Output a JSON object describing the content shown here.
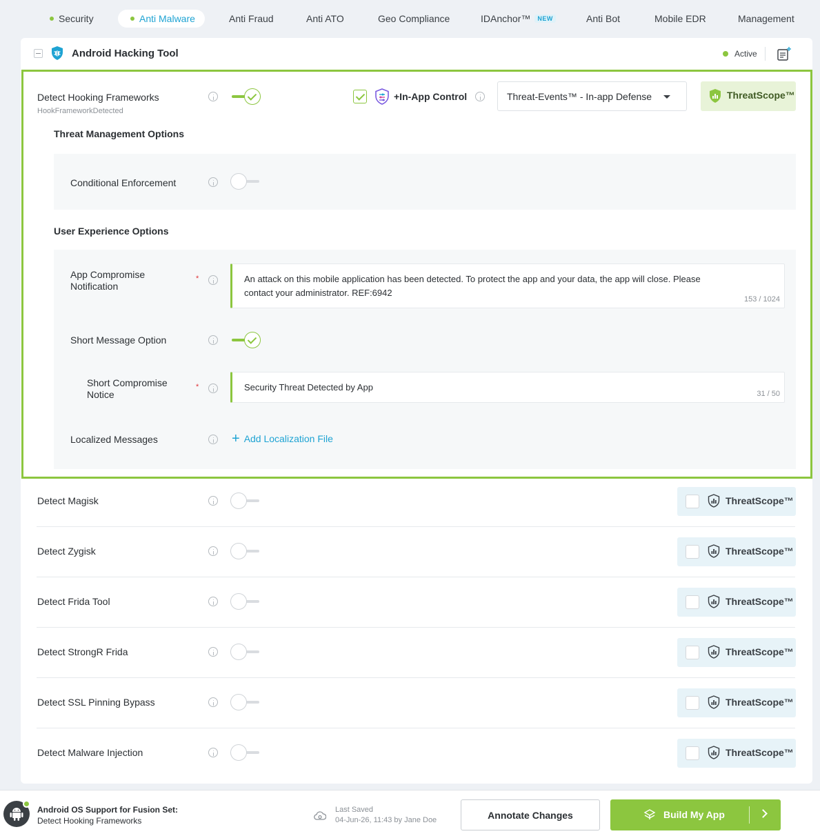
{
  "nav": {
    "tabs": [
      {
        "label": "Security"
      },
      {
        "label": "Anti Malware"
      },
      {
        "label": "Anti Fraud"
      },
      {
        "label": "Anti ATO"
      },
      {
        "label": "Geo Compliance"
      },
      {
        "label": "IDAnchor™",
        "badge": "NEW"
      },
      {
        "label": "Anti Bot"
      },
      {
        "label": "Mobile EDR"
      },
      {
        "label": "Management"
      }
    ],
    "active_tab": "Anti Malware"
  },
  "card": {
    "title": "Android Hacking Tool",
    "status": "Active"
  },
  "expanded": {
    "feature": "Detect Hooking Frameworks",
    "feature_code": "HookFrameworkDetected",
    "enabled": true,
    "in_app_checked": true,
    "in_app_label": "+In-App Control",
    "dropdown_value": "Threat-Events™ - In-app Defense",
    "threatscope_label": "ThreatScope™",
    "threat_mgmt_title": "Threat Management Options",
    "conditional_label": "Conditional Enforcement",
    "conditional_enabled": false,
    "ux_title": "User Experience Options",
    "notification_label": "App Compromise Notification",
    "notification_text": "An attack on this mobile application has been detected. To protect the app and your data, the app will close. Please contact your administrator. REF:6942",
    "notification_count": "153 / 1024",
    "short_msg_label": "Short Message Option",
    "short_msg_enabled": true,
    "short_notice_label": "Short Compromise Notice",
    "short_notice_text": "Security Threat Detected by App",
    "short_notice_count": "31 / 50",
    "localized_label": "Localized Messages",
    "add_localization": "Add Localization File",
    "required_mark": "*"
  },
  "rows": [
    {
      "label": "Detect Magisk",
      "enabled": false,
      "threatscope": "ThreatScope™"
    },
    {
      "label": "Detect Zygisk",
      "enabled": false,
      "threatscope": "ThreatScope™"
    },
    {
      "label": "Detect Frida Tool",
      "enabled": false,
      "threatscope": "ThreatScope™"
    },
    {
      "label": "Detect StrongR Frida",
      "enabled": false,
      "threatscope": "ThreatScope™"
    },
    {
      "label": "Detect SSL Pinning Bypass",
      "enabled": false,
      "threatscope": "ThreatScope™"
    },
    {
      "label": "Detect Malware Injection",
      "enabled": false,
      "threatscope": "ThreatScope™"
    }
  ],
  "footer": {
    "title": "Android OS Support for Fusion Set:",
    "subtitle": "Detect Hooking Frameworks",
    "saved_label": "Last Saved",
    "saved_value": "04-Jun-26, 11:43 by Jane Doe",
    "annotate_label": "Annotate Changes",
    "build_label": "Build My App"
  },
  "icons": {
    "collapse": "minus-square-icon",
    "card_logo": "shield-bug-icon",
    "note": "note-add-icon",
    "info": "info-icon",
    "in_app": "shield-sliders-icon",
    "threatscope": "shield-chart-icon",
    "saved": "cloud-sync-icon",
    "build": "build-icon",
    "arrow": "chevron-right-icon",
    "android": "android-icon"
  },
  "colors": {
    "accent_green": "#8cc63f",
    "link_blue": "#1ea3d3",
    "required_red": "#e0343a"
  }
}
